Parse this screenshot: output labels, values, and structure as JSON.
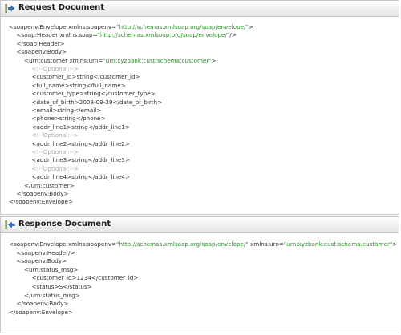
{
  "colors": {
    "tag": "#333333",
    "value": "#2a8c2a",
    "comment": "#a6a6a6",
    "icon_arrow": "#3a6fb5",
    "icon_bar": "#5a7a3a"
  },
  "request": {
    "title": "Request Document",
    "icon": "arrow-right-icon",
    "lines": [
      {
        "indent": 0,
        "parts": [
          {
            "t": "<soapenv:Envelope xmlns:soapenv="
          },
          {
            "v": "\"http://schemas.xmlsoap.org/soap/envelope/\""
          },
          {
            "t": ">"
          }
        ]
      },
      {
        "indent": 1,
        "parts": [
          {
            "t": "<soap:Header xmlns:soap="
          },
          {
            "v": "\"http://schemas.xmlsoap.org/soap/envelope/\""
          },
          {
            "t": "/>"
          }
        ]
      },
      {
        "indent": 1,
        "parts": [
          {
            "t": "</soap:Header>"
          }
        ]
      },
      {
        "indent": 1,
        "parts": [
          {
            "t": "<soapenv:Body>"
          }
        ]
      },
      {
        "indent": 2,
        "parts": [
          {
            "t": "<urn:customer xmlns:urn="
          },
          {
            "v": "\"urn:xyzbank:cust:schema:customer\""
          },
          {
            "t": ">"
          }
        ]
      },
      {
        "indent": 3,
        "parts": [
          {
            "c": "<!--Optional:-->"
          }
        ]
      },
      {
        "indent": 3,
        "parts": [
          {
            "t": "<customer_id>string</customer_id>"
          }
        ]
      },
      {
        "indent": 3,
        "parts": [
          {
            "t": "<full_name>string</full_name>"
          }
        ]
      },
      {
        "indent": 3,
        "parts": [
          {
            "t": "<customer_type>string</customer_type>"
          }
        ]
      },
      {
        "indent": 3,
        "parts": [
          {
            "t": "<date_of_birth>2008-09-29</date_of_birth>"
          }
        ]
      },
      {
        "indent": 3,
        "parts": [
          {
            "t": "<email>string</email>"
          }
        ]
      },
      {
        "indent": 3,
        "parts": [
          {
            "t": "<phone>string</phone>"
          }
        ]
      },
      {
        "indent": 3,
        "parts": [
          {
            "t": "<addr_line1>string</addr_line1>"
          }
        ]
      },
      {
        "indent": 3,
        "parts": [
          {
            "c": "<!--Optional:-->"
          }
        ]
      },
      {
        "indent": 3,
        "parts": [
          {
            "t": "<addr_line2>string</addr_line2>"
          }
        ]
      },
      {
        "indent": 3,
        "parts": [
          {
            "c": "<!--Optional:-->"
          }
        ]
      },
      {
        "indent": 3,
        "parts": [
          {
            "t": "<addr_line3>string</addr_line3>"
          }
        ]
      },
      {
        "indent": 3,
        "parts": [
          {
            "c": "<!--Optional:-->"
          }
        ]
      },
      {
        "indent": 3,
        "parts": [
          {
            "t": "<addr_line4>string</addr_line4>"
          }
        ]
      },
      {
        "indent": 2,
        "parts": [
          {
            "t": "</urn:customer>"
          }
        ]
      },
      {
        "indent": 1,
        "parts": [
          {
            "t": "</soapenv:Body>"
          }
        ]
      },
      {
        "indent": 0,
        "parts": [
          {
            "t": "</soapenv:Envelope>"
          }
        ]
      }
    ]
  },
  "response": {
    "title": "Response Document",
    "icon": "arrow-left-icon",
    "lines": [
      {
        "indent": 0,
        "parts": [
          {
            "t": "<soapenv:Envelope xmlns:soapenv="
          },
          {
            "v": "\"http://schemas.xmlsoap.org/soap/envelope/\""
          },
          {
            "t": " xmlns:urn="
          },
          {
            "v": "\"urn:xyzbank:cust:schema:customer\""
          },
          {
            "t": ">"
          }
        ]
      },
      {
        "indent": 1,
        "parts": [
          {
            "t": "<soapenv:Header/>"
          }
        ]
      },
      {
        "indent": 1,
        "parts": [
          {
            "t": "<soapenv:Body>"
          }
        ]
      },
      {
        "indent": 2,
        "parts": [
          {
            "t": "<urn:status_msg>"
          }
        ]
      },
      {
        "indent": 3,
        "parts": [
          {
            "t": "<customer_id>1234</customer_id>"
          }
        ]
      },
      {
        "indent": 3,
        "parts": [
          {
            "t": "<status>S</status>"
          }
        ]
      },
      {
        "indent": 2,
        "parts": [
          {
            "t": "</urn:status_msg>"
          }
        ]
      },
      {
        "indent": 1,
        "parts": [
          {
            "t": "</soapenv:Body>"
          }
        ]
      },
      {
        "indent": 0,
        "parts": [
          {
            "t": "</soapenv:Envelope>"
          }
        ]
      }
    ]
  }
}
